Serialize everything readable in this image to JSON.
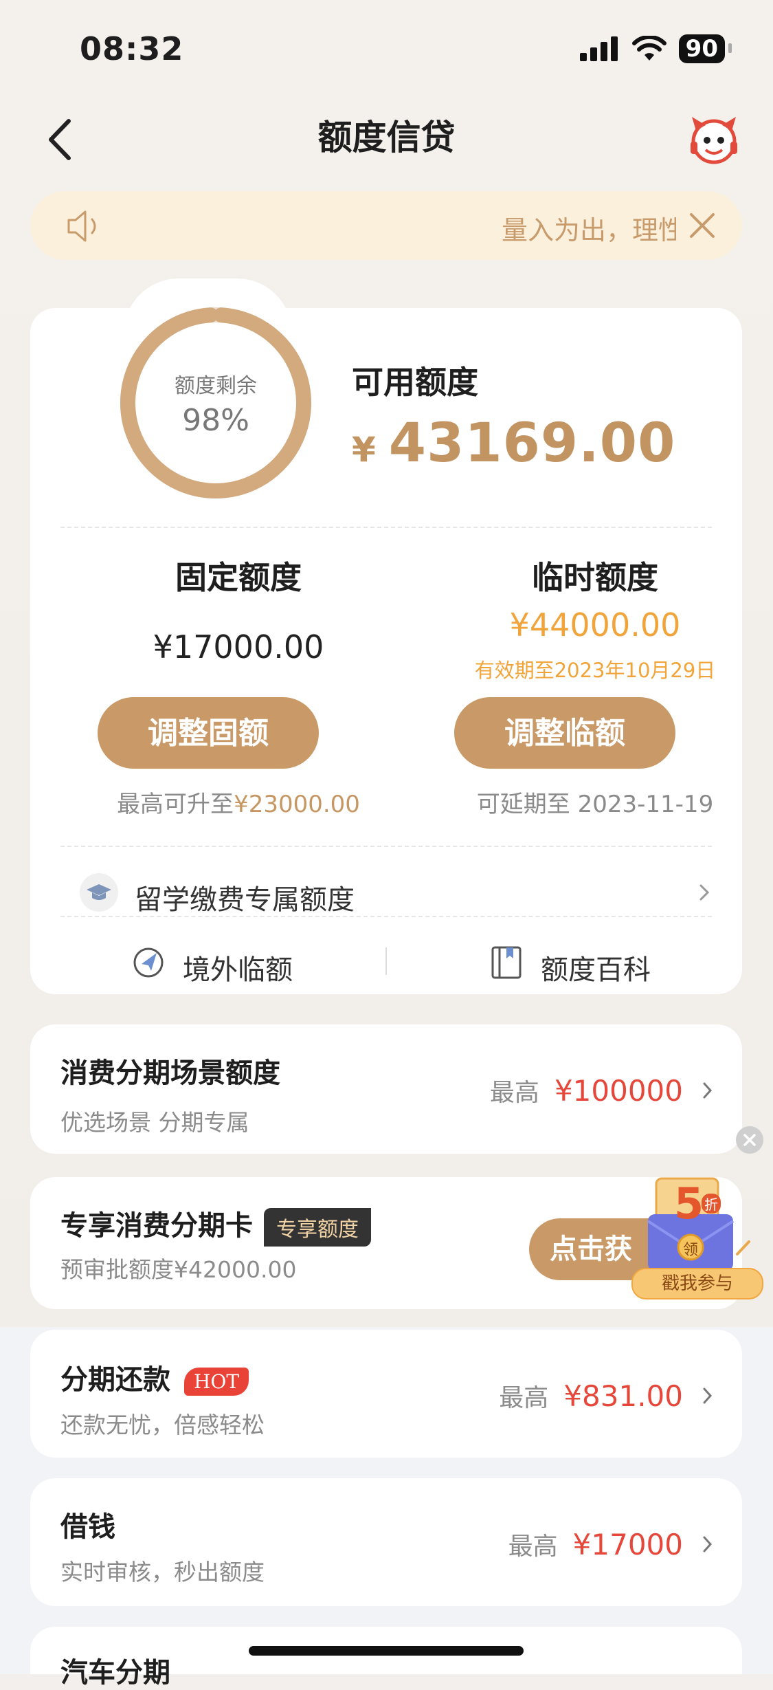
{
  "status_bar": {
    "time": "08:32",
    "battery": "90"
  },
  "nav": {
    "title": "额度信贷"
  },
  "notice": {
    "text": "量入为出，理性消费"
  },
  "credit": {
    "ring_label": "额度剩余",
    "ring_percent": "98%",
    "remaining_fraction": 0.98,
    "available_label": "可用额度",
    "currency": "¥",
    "available_amount": "43169.00",
    "fixed": {
      "title": "固定额度",
      "amount": "¥17000.00",
      "button": "调整固额",
      "footer_prefix": "最高可升至",
      "footer_value": "¥23000.00"
    },
    "temp": {
      "title": "临时额度",
      "amount": "¥44000.00",
      "validity": "有效期至2023年10月29日",
      "button": "调整临额",
      "footer": "可延期至 2023-11-19"
    },
    "study_abroad": "留学缴费专属额度",
    "tools": [
      "境外临额",
      "额度百科"
    ]
  },
  "items": [
    {
      "title": "消费分期场景额度",
      "sub": "优选场景 分期专属",
      "prefix": "最高",
      "amount": "¥100000"
    },
    {
      "title": "专享消费分期卡",
      "tag": "专享额度",
      "sub": "预审批额度¥42000.00",
      "button": "点击获"
    },
    {
      "title": "分期还款",
      "tag": "HOT",
      "sub": "还款无忧，倍感轻松",
      "prefix": "最高",
      "amount": "¥831.00"
    },
    {
      "title": "借钱",
      "sub": "实时审核，秒出额度",
      "prefix": "最高",
      "amount": "¥17000"
    },
    {
      "title": "汽车分期"
    }
  ],
  "promo": {
    "badge": "5",
    "badge_unit": "折",
    "coin": "领",
    "cta": "戳我参与"
  },
  "colors": {
    "accent": "#c99a67",
    "price_red": "#e5483a",
    "temp_orange": "#f0a43a",
    "notice_bg": "#fbf0dc"
  }
}
